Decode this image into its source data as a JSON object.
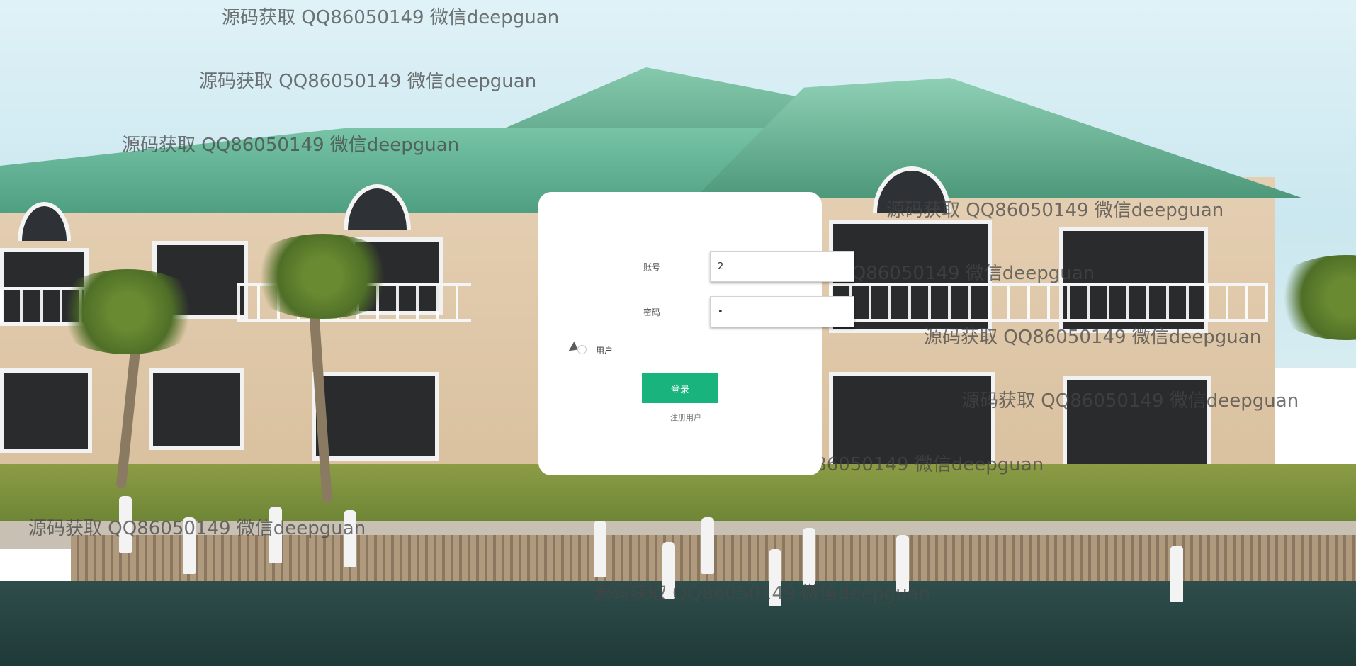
{
  "watermark_text": "源码获取 QQ86050149 微信deepguan",
  "login": {
    "account_label": "账号",
    "account_value": "2",
    "password_label": "密码",
    "password_value": "•",
    "role_option_label": "用户",
    "login_button": "登录",
    "register_link": "注册用户"
  },
  "colors": {
    "accent": "#19b47d",
    "card_bg": "#ffffff"
  }
}
